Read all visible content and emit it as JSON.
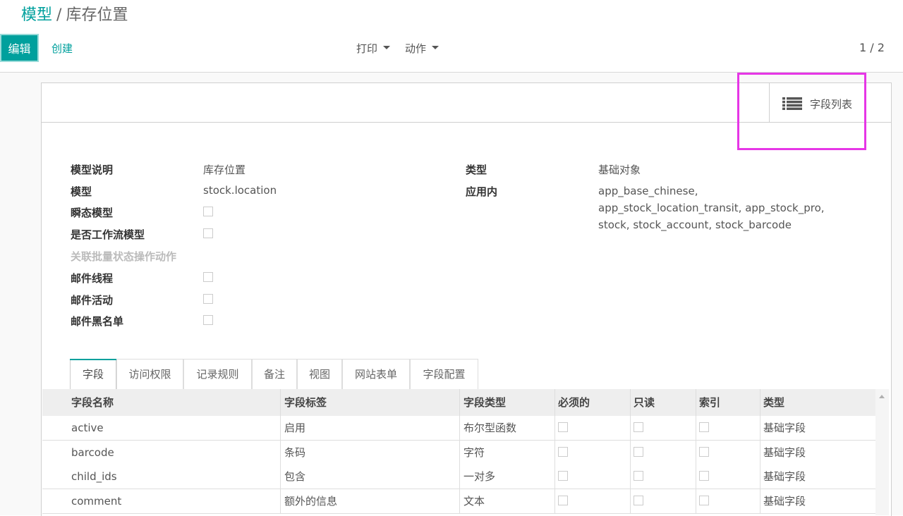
{
  "breadcrumb": {
    "parent": "模型",
    "separator": "/",
    "current": "库存位置"
  },
  "buttons": {
    "edit": "编辑",
    "create": "创建"
  },
  "toolbar": {
    "print": "打印",
    "action": "动作"
  },
  "pager": "1 / 2",
  "smart_button": {
    "label": "字段列表",
    "icon": "list-icon"
  },
  "form": {
    "desc_label": "模型说明",
    "desc_value": "库存位置",
    "model_label": "模型",
    "model_value": "stock.location",
    "transient_label": "瞬态模型",
    "workflow_label": "是否工作流模型",
    "batch_label": "关联批量状态操作动作",
    "mail_thread_label": "邮件线程",
    "mail_activity_label": "邮件活动",
    "mail_blacklist_label": "邮件黑名单",
    "type_label": "类型",
    "type_value": "基础对象",
    "apps_label": "应用内",
    "apps_value": "app_base_chinese, app_stock_location_transit, app_stock_pro, stock, stock_account, stock_barcode"
  },
  "tabs": [
    "字段",
    "访问权限",
    "记录规则",
    "备注",
    "视图",
    "网站表单",
    "字段配置"
  ],
  "table": {
    "headers": [
      "字段名称",
      "字段标签",
      "字段类型",
      "必须的",
      "只读",
      "索引",
      "类型"
    ],
    "rows": [
      {
        "name": "active",
        "label": "启用",
        "ftype": "布尔型函数",
        "kind": "基础字段"
      },
      {
        "name": "barcode",
        "label": "条码",
        "ftype": "字符",
        "kind": "基础字段"
      },
      {
        "name": "child_ids",
        "label": "包含",
        "ftype": "一对多",
        "kind": "基础字段"
      },
      {
        "name": "comment",
        "label": "额外的信息",
        "ftype": "文本",
        "kind": "基础字段"
      }
    ]
  },
  "colors": {
    "accent": "#00a09d",
    "highlight": "#e636e6"
  }
}
